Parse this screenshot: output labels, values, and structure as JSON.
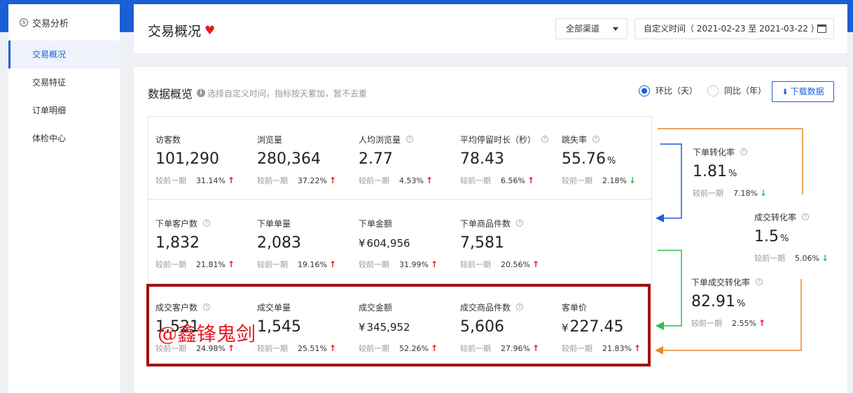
{
  "sidebar": {
    "title": "交易分析",
    "items": [
      {
        "label": "交易概况",
        "active": true
      },
      {
        "label": "交易特征",
        "active": false
      },
      {
        "label": "订单明细",
        "active": false
      },
      {
        "label": "体检中心",
        "active": false
      }
    ]
  },
  "header": {
    "title": "交易概况",
    "channel": "全部渠道",
    "date_range": "自定义时间（ 2021-02-23 至 2021-03-22 ）"
  },
  "overview": {
    "title": "数据概览",
    "hint": "选择自定义时间，指标按天累加，暂不去重",
    "radio_1": "环比（天）",
    "radio_2": "同比（年）",
    "download": "下载数据",
    "compare_label": "较前一期"
  },
  "metrics": {
    "visitors": {
      "label": "访客数",
      "value": "101,290",
      "change": "31.14%",
      "trend": "up"
    },
    "pageviews": {
      "label": "浏览量",
      "value": "280,364",
      "change": "37.22%",
      "trend": "up"
    },
    "avg_views": {
      "label": "人均浏览量",
      "value": "2.77",
      "change": "4.53%",
      "trend": "up"
    },
    "avg_stay": {
      "label": "平均停留时长（秒）",
      "value": "78.43",
      "change": "6.56%",
      "trend": "up"
    },
    "bounce": {
      "label": "跳失率",
      "value": "55.76",
      "unit": "%",
      "change": "2.18%",
      "trend": "down"
    },
    "order_customers": {
      "label": "下单客户数",
      "value": "1,832",
      "change": "21.81%",
      "trend": "up"
    },
    "order_count": {
      "label": "下单单量",
      "value": "2,083",
      "change": "19.16%",
      "trend": "up"
    },
    "order_amount": {
      "label": "下单金额",
      "currency": "¥",
      "value": "604,956",
      "change": "31.99%",
      "trend": "up"
    },
    "order_items": {
      "label": "下单商品件数",
      "value": "7,581",
      "change": "20.56%",
      "trend": "up"
    },
    "deal_customers": {
      "label": "成交客户数",
      "value": "1,521",
      "change": "24.98%",
      "trend": "up"
    },
    "deal_count": {
      "label": "成交单量",
      "value": "1,545",
      "change": "25.51%",
      "trend": "up"
    },
    "deal_amount": {
      "label": "成交金额",
      "currency": "¥",
      "value": "345,952",
      "change": "52.26%",
      "trend": "up"
    },
    "deal_items": {
      "label": "成交商品件数",
      "value": "5,606",
      "change": "27.96%",
      "trend": "up"
    },
    "avg_price": {
      "label": "客单价",
      "currency": "¥",
      "value": "227.45",
      "change": "21.83%",
      "trend": "up"
    }
  },
  "funnel": {
    "order_conv": {
      "label": "下单转化率",
      "value": "1.81",
      "unit": "%",
      "change": "7.18%",
      "trend": "down"
    },
    "deal_conv": {
      "label": "成交转化率",
      "value": "1.5",
      "unit": "%",
      "change": "5.06%",
      "trend": "down"
    },
    "order_deal_conv": {
      "label": "下单成交转化率",
      "value": "82.91",
      "unit": "%",
      "change": "2.55%",
      "trend": "up"
    }
  },
  "watermark": "@鑫锋鬼剑",
  "colors": {
    "primary": "#1a5fd6",
    "up": "#e31b23",
    "down": "#2ebd4a",
    "highlight": "#a50f12",
    "orange": "#e8892a",
    "green": "#2ebd4a",
    "blue": "#1a5fd6"
  }
}
